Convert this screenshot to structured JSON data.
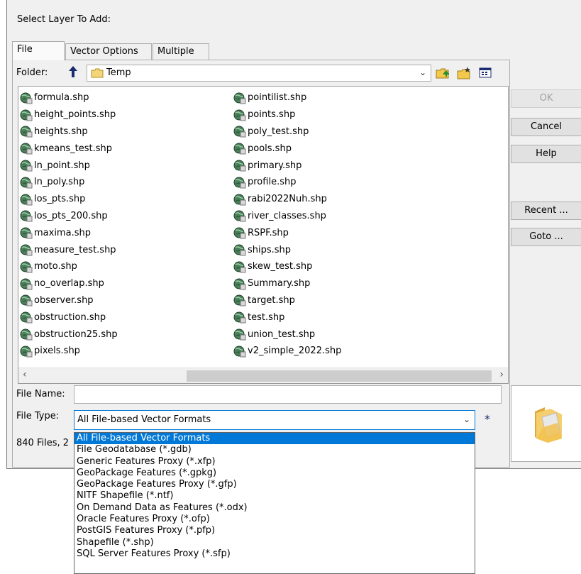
{
  "dialog": {
    "title": "Select Layer To Add:",
    "tabs": [
      "File",
      "Vector Options",
      "Multiple"
    ],
    "folder_label": "Folder:",
    "folder_value": "Temp",
    "files_left": [
      "formula.shp",
      "height_points.shp",
      "heights.shp",
      "kmeans_test.shp",
      "ln_point.shp",
      "ln_poly.shp",
      "los_pts.shp",
      "los_pts_200.shp",
      "maxima.shp",
      "measure_test.shp",
      "moto.shp",
      "no_overlap.shp",
      "observer.shp",
      "obstruction.shp",
      "obstruction25.shp",
      "pixels.shp"
    ],
    "files_right": [
      "pointilist.shp",
      "points.shp",
      "poly_test.shp",
      "pools.shp",
      "primary.shp",
      "profile.shp",
      "rabi2022Nuh.shp",
      "river_classes.shp",
      "RSPF.shp",
      "ships.shp",
      "skew_test.shp",
      "Summary.shp",
      "target.shp",
      "test.shp",
      "union_test.shp",
      "v2_simple_2022.shp"
    ],
    "file_name_label": "File Name:",
    "file_name_value": "",
    "file_type_label": "File Type:",
    "file_type_value": "All File-based Vector Formats",
    "status_text": "840 Files, 2",
    "asterisk": "*",
    "buttons": {
      "ok": "OK",
      "cancel": "Cancel",
      "help": "Help",
      "recent": "Recent ...",
      "goto": "Goto ..."
    }
  },
  "dropdown_options": [
    "All File-based Vector Formats",
    "File Geodatabase (*.gdb)",
    "Generic Features Proxy (*.xfp)",
    "GeoPackage Features (*.gpkg)",
    "GeoPackage Features Proxy (*.gfp)",
    "NITF Shapefile (*.ntf)",
    "On Demand Data as Features (*.odx)",
    "Oracle Features Proxy (*.ofp)",
    "PostGIS Features Proxy (*.pfp)",
    "Shapefile (*.shp)",
    "SQL Server Features Proxy (*.sfp)"
  ],
  "colors": {
    "selection": "#0078d7",
    "dialog_bg": "#f0f0f0"
  }
}
